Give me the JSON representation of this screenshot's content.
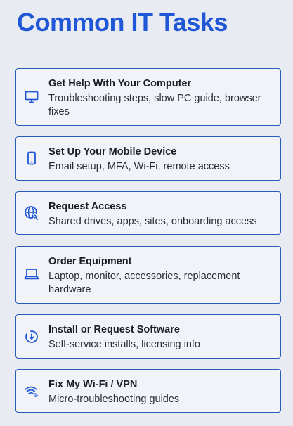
{
  "page": {
    "title": "Common IT Tasks"
  },
  "accent_color": "#1f57d6",
  "border_color": "#2b5bb8",
  "tasks": [
    {
      "icon": "desktop-monitor-icon",
      "title": "Get Help With Your Computer",
      "description": "Troubleshooting steps, slow PC guide, browser fixes"
    },
    {
      "icon": "mobile-phone-icon",
      "title": "Set Up Your Mobile Device",
      "description": "Email setup, MFA, Wi-Fi, remote access"
    },
    {
      "icon": "globe-key-icon",
      "title": "Request Access",
      "description": "Shared drives, apps, sites, onboarding access"
    },
    {
      "icon": "laptop-icon",
      "title": "Order Equipment",
      "description": "Laptop, monitor, accessories, replacement hardware"
    },
    {
      "icon": "download-circle-icon",
      "title": "Install or Request Software",
      "description": "Self-service installs, licensing info"
    },
    {
      "icon": "wifi-gear-icon",
      "title": "Fix My Wi-Fi / VPN",
      "description": "Micro-troubleshooting guides"
    }
  ]
}
